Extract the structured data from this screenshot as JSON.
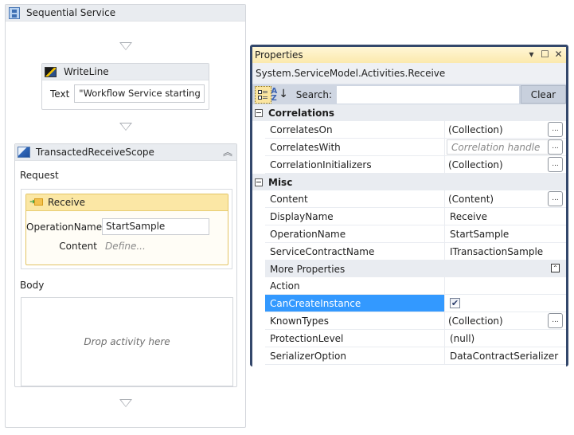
{
  "designer": {
    "sequence": {
      "title": "Sequential Service",
      "icon": "sequence-icon"
    },
    "writeline": {
      "title": "WriteLine",
      "icon": "writeline-icon",
      "text_label": "Text",
      "text_value": "\"Workflow Service starting ...\""
    },
    "scope": {
      "title": "TransactedReceiveScope",
      "icon": "transacted-receive-scope-icon",
      "request_label": "Request",
      "body_label": "Body",
      "body_placeholder": "Drop activity here",
      "receive": {
        "title": "Receive",
        "icon": "receive-icon",
        "operation_label": "OperationName",
        "operation_value": "StartSample",
        "content_label": "Content",
        "content_link": "Define..."
      }
    }
  },
  "properties": {
    "title": "Properties",
    "window_buttons": {
      "dropdown": "▾",
      "maximize": "☐",
      "close": "✕"
    },
    "type_name": "System.ServiceModel.Activities.Receive",
    "toolbar": {
      "search_label": "Search:",
      "search_value": "",
      "clear_label": "Clear"
    },
    "categories": [
      {
        "name": "Correlations",
        "rows": [
          {
            "name": "CorrelatesOn",
            "value": "(Collection)",
            "ellipsis": true
          },
          {
            "name": "CorrelatesWith",
            "value": "",
            "placeholder": "Correlation handle",
            "ellipsis": true
          },
          {
            "name": "CorrelationInitializers",
            "value": "(Collection)",
            "ellipsis": true
          }
        ]
      },
      {
        "name": "Misc",
        "rows": [
          {
            "name": "Content",
            "value": "(Content)",
            "ellipsis": true
          },
          {
            "name": "DisplayName",
            "value": "Receive"
          },
          {
            "name": "OperationName",
            "value": "StartSample"
          },
          {
            "name": "ServiceContractName",
            "value": "ITransactionSample"
          }
        ],
        "more_properties_label": "More Properties",
        "more_rows": [
          {
            "name": "Action",
            "value": ""
          },
          {
            "name": "CanCreateInstance",
            "checked": true,
            "selected": true
          },
          {
            "name": "KnownTypes",
            "value": "(Collection)",
            "ellipsis": true
          },
          {
            "name": "ProtectionLevel",
            "value": "(null)"
          },
          {
            "name": "SerializerOption",
            "value": "DataContractSerializer"
          }
        ]
      }
    ],
    "colors": {
      "selection": "#3399ff",
      "border": "#33476b",
      "title_bg": "#fbe9ad"
    }
  }
}
